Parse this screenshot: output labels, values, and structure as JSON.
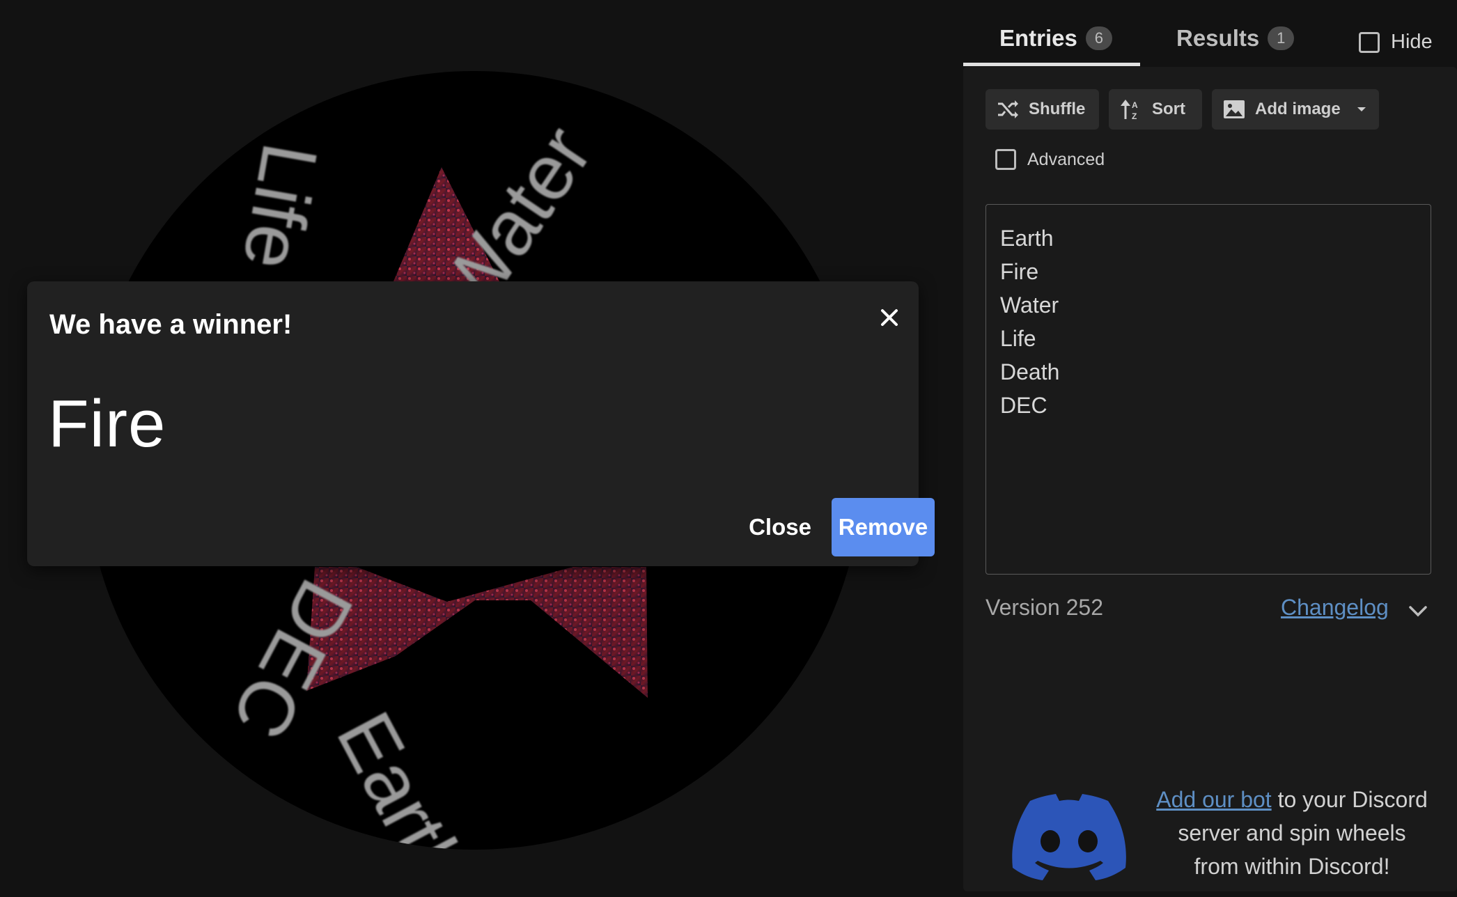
{
  "wheel": {
    "labels": [
      "Life",
      "Water",
      "Earth",
      "DEC"
    ]
  },
  "modal": {
    "title": "We have a winner!",
    "winner": "Fire",
    "close_label": "Close",
    "remove_label": "Remove",
    "close_icon": "close-icon"
  },
  "tabs": [
    {
      "label": "Entries",
      "count": "6",
      "active": true
    },
    {
      "label": "Results",
      "count": "1",
      "active": false
    }
  ],
  "hide": {
    "label": "Hide",
    "checked": false
  },
  "toolbar": {
    "shuffle_label": "Shuffle",
    "sort_label": "Sort",
    "add_image_label": "Add image"
  },
  "advanced": {
    "label": "Advanced",
    "checked": false
  },
  "entries": [
    "Earth",
    "Fire",
    "Water",
    "Life",
    "Death",
    "DEC"
  ],
  "footer": {
    "version": "Version 252",
    "changelog": "Changelog"
  },
  "discord": {
    "link_text": "Add our bot",
    "text_rest_1": " to your Discord",
    "text_line_2": "server and spin wheels",
    "text_line_3": "from within Discord!"
  },
  "colors": {
    "accent": "#5b8def",
    "link": "#5e8fc4",
    "discord_blue": "#2c55b8"
  }
}
